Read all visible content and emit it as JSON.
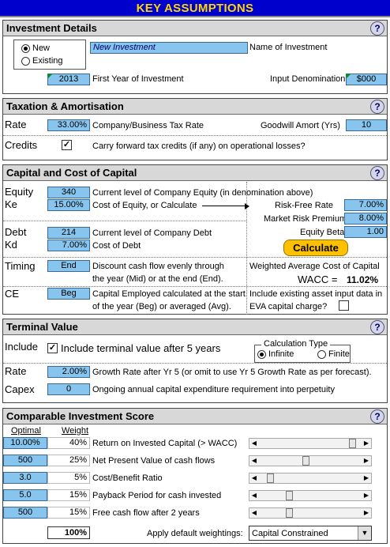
{
  "title": "KEY ASSUMPTIONS",
  "investment_details": {
    "heading": "Investment Details",
    "help": "?",
    "radio_new": "New",
    "radio_existing": "Existing",
    "name_value": "New Investment",
    "name_label": "Name of Investment",
    "first_year_value": "2013",
    "first_year_label": "First Year of Investment",
    "denomination_label": "Input Denomination",
    "denomination_value": "$000"
  },
  "taxation": {
    "heading": "Taxation & Amortisation",
    "help": "?",
    "rate_label": "Rate",
    "rate_value": "33.00%",
    "rate_desc": "Company/Business Tax Rate",
    "goodwill_label": "Goodwill Amort (Yrs)",
    "goodwill_value": "10",
    "credits_label": "Credits",
    "credits_checked": true,
    "credits_desc": "Carry forward tax credits (if any) on operational losses?"
  },
  "capital": {
    "heading": "Capital and Cost of Capital",
    "help": "?",
    "equity_label": "Equity",
    "equity_value": "340",
    "equity_desc": "Current level of Company Equity (in denomination above)",
    "ke_label": "Ke",
    "ke_value": "15.00%",
    "ke_desc": "Cost of Equity, or Calculate",
    "rf_label": "Risk-Free Rate",
    "rf_value": "7.00%",
    "mrp_label": "Market Risk Premium",
    "mrp_value": "8.00%",
    "beta_label": "Equity Beta",
    "beta_value": "1.00",
    "debt_label": "Debt",
    "debt_value": "214",
    "debt_desc": "Current level of Company Debt",
    "kd_label": "Kd",
    "kd_value": "7.00%",
    "kd_desc": "Cost of Debt",
    "calculate_label": "Calculate",
    "timing_label": "Timing",
    "timing_value": "End",
    "timing_desc1": "Discount cash flow evenly through",
    "timing_desc2": "the year (Mid) or at the end (End).",
    "wacc_title": "Weighted Average Cost of Capital",
    "wacc_label": "WACC =",
    "wacc_value": "11.02%",
    "ce_label": "CE",
    "ce_value": "Beg",
    "ce_desc1": "Capital Employed calculated at the start",
    "ce_desc2": "of the year (Beg) or averaged (Avg).",
    "eva_desc1": "Include existing asset input data in",
    "eva_desc2": "EVA capital charge?",
    "eva_checked": false
  },
  "terminal": {
    "heading": "Terminal Value",
    "help": "?",
    "include_label": "Include",
    "include_checked": true,
    "include_desc": "Include terminal value after 5 years",
    "calc_type_title": "Calculation Type",
    "calc_infinite": "Infinite",
    "calc_finite": "Finite",
    "rate_label": "Rate",
    "rate_value": "2.00%",
    "rate_desc": "Growth Rate after Yr 5 (or omit to use Yr 5 Growth Rate as per forecast).",
    "capex_label": "Capex",
    "capex_value": "0",
    "capex_desc": "Ongoing annual capital expenditure requirement into perpetuity"
  },
  "score": {
    "heading": "Comparable Investment Score",
    "help": "?",
    "col_optimal": "Optimal",
    "col_weight": "Weight",
    "rows": [
      {
        "optimal": "10.00%",
        "weight": "40%",
        "label": "Return on Invested Capital (> WACC)",
        "slider": 0.93
      },
      {
        "optimal": "500",
        "weight": "25%",
        "label": "Net Present Value of cash flows",
        "slider": 0.45
      },
      {
        "optimal": "3.0",
        "weight": "5%",
        "label": "Cost/Benefit Ratio",
        "slider": 0.08
      },
      {
        "optimal": "5.0",
        "weight": "15%",
        "label": "Payback Period for cash invested",
        "slider": 0.28
      },
      {
        "optimal": "500",
        "weight": "15%",
        "label": "Free cash flow after 2 years",
        "slider": 0.28
      }
    ],
    "total_weight": "100%",
    "default_label": "Apply default weightings:",
    "default_value": "Capital Constrained"
  }
}
